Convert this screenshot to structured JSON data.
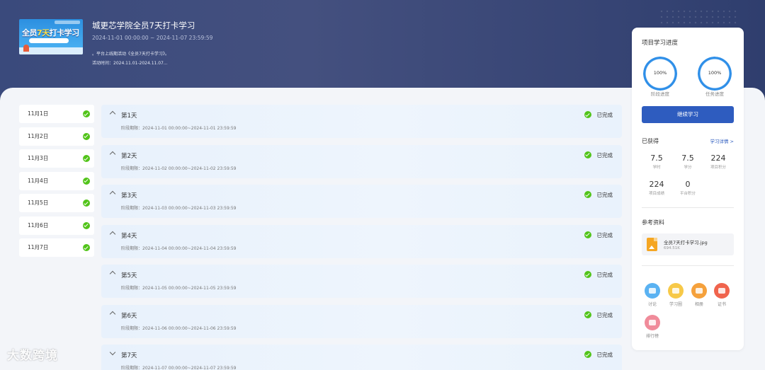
{
  "course": {
    "title": "城更芯学院全员7天打卡学习",
    "dates": "2024-11-01 00:00:00 ~ 2024-11-07 23:59:59",
    "note": "。平台上线期活动《全员7天打卡学习》。",
    "activity_time": "活动时间：2024.11.01-2024.11.07...",
    "cover": {
      "text_a": "全员",
      "text_b": "7天",
      "text_c": "打卡学习"
    }
  },
  "days": [
    {
      "label": "11月1日"
    },
    {
      "label": "11月2日"
    },
    {
      "label": "11月3日"
    },
    {
      "label": "11月4日"
    },
    {
      "label": "11月5日"
    },
    {
      "label": "11月6日"
    },
    {
      "label": "11月7日"
    }
  ],
  "stages": [
    {
      "title": "第1天",
      "period": "阶段期限：2024-11-01 00:00:00~2024-11-01 23:59:59",
      "status": "已完成",
      "expanded": true
    },
    {
      "title": "第2天",
      "period": "阶段期限：2024-11-02 00:00:00~2024-11-02 23:59:59",
      "status": "已完成",
      "expanded": true
    },
    {
      "title": "第3天",
      "period": "阶段期限：2024-11-03 00:00:00~2024-11-03 23:59:59",
      "status": "已完成",
      "expanded": true
    },
    {
      "title": "第4天",
      "period": "阶段期限：2024-11-04 00:00:00~2024-11-04 23:59:59",
      "status": "已完成",
      "expanded": true
    },
    {
      "title": "第5天",
      "period": "阶段期限：2024-11-05 00:00:00~2024-11-05 23:59:59",
      "status": "已完成",
      "expanded": true
    },
    {
      "title": "第6天",
      "period": "阶段期限：2024-11-06 00:00:00~2024-11-06 23:59:59",
      "status": "已完成",
      "expanded": true
    },
    {
      "title": "第7天",
      "period": "阶段期限：2024-11-07 00:00:00~2024-11-07 23:59:59",
      "status": "已完成",
      "expanded": false
    }
  ],
  "panel": {
    "title": "项目学习进度",
    "progress": [
      {
        "value": "100%",
        "label": "阶段进度",
        "fraction": 1.0
      },
      {
        "value": "100%",
        "label": "任务进度",
        "fraction": 1.0
      }
    ],
    "continue_button": "继续学习",
    "earned_title": "已获得",
    "detail_link": "学习详情 >",
    "stats": [
      {
        "value": "7.5",
        "label": "学时"
      },
      {
        "value": "7.5",
        "label": "学分"
      },
      {
        "value": "224",
        "label": "项目积分"
      },
      {
        "value": "224",
        "label": "项目成绩"
      },
      {
        "value": "0",
        "label": "平台积分"
      }
    ],
    "refs_title": "参考资料",
    "file": {
      "name": "全员7天打卡学习.jpg",
      "size": "694.51K"
    },
    "tools": [
      {
        "label": "讨论",
        "icon": "chat-icon",
        "color": "#5ab2f2"
      },
      {
        "label": "学习圈",
        "icon": "note-icon",
        "color": "#f7c948"
      },
      {
        "label": "相册",
        "icon": "image-icon",
        "color": "#f5a13c"
      },
      {
        "label": "证书",
        "icon": "award-icon",
        "color": "#f0644d"
      },
      {
        "label": "排行榜",
        "icon": "ranking-icon",
        "color": "#f08b9a"
      }
    ]
  },
  "watermark": "大数跨境",
  "colors": {
    "accent": "#2e5cbf",
    "success": "#52c41a",
    "ring": "#2f8fe8",
    "hero": "#3a4a7c"
  }
}
